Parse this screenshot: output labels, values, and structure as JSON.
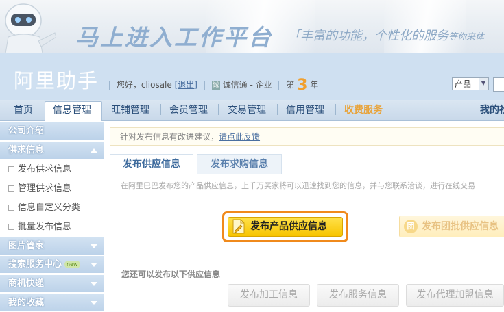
{
  "banner": {
    "slogan": "马上进入工作平台",
    "tagline": "「丰富的功能，个性化的服务",
    "tagline_small": "等你来体"
  },
  "header": {
    "app_title": "阿里助手",
    "greeting": "您好，",
    "username": "cliosale",
    "logout": "[退出]",
    "membership": "诚信通 - 企业",
    "year_prefix": "第",
    "year_number": "3",
    "year_suffix": "年",
    "search_select_value": "产品"
  },
  "nav": {
    "items": [
      "首页",
      "信息管理",
      "旺铺管理",
      "会员管理",
      "交易管理",
      "信用管理",
      "收费服务"
    ],
    "active": "信息管理",
    "right": "我的社"
  },
  "sidebar": {
    "company_intro": "公司介绍",
    "supply_info": "供求信息",
    "sub_items": [
      "发布供求信息",
      "管理供求信息",
      "信息自定义分类",
      "批量发布信息"
    ],
    "image_manager": "图片管家",
    "search_center": "搜索服务中心",
    "new_badge": "new",
    "biz_express": "商机快递",
    "favorites": "我的收藏"
  },
  "main": {
    "notice_text": "针对发布信息有改进建议，",
    "notice_link": "请点此反馈",
    "tabs": [
      "发布供应信息",
      "发布求购信息"
    ],
    "intro": "在阿里巴巴发布您的产品供应信息，上千万买家将可以迅速找到您的信息，并与您联系洽谈，进行在线交易",
    "publish_button": "发布产品供应信息",
    "group_button": "发布团批供应信息",
    "more_label": "您还可以发布以下供应信息",
    "more_buttons": [
      "发布加工信息",
      "发布服务信息",
      "发布代理加盟信息"
    ]
  },
  "colors": {
    "accent_orange": "#f08a1c",
    "button_yellow": "#f7c400",
    "nav_blue": "#2b4f7a",
    "paid_service": "#e8a33a"
  }
}
